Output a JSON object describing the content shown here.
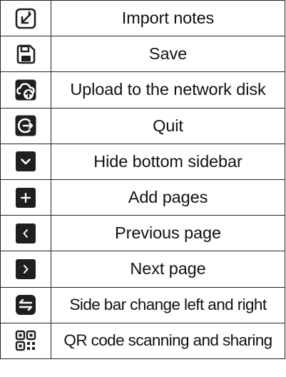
{
  "rows": [
    {
      "icon": "import-icon",
      "label": "Import notes"
    },
    {
      "icon": "save-icon",
      "label": "Save"
    },
    {
      "icon": "cloud-upload-icon",
      "label": "Upload to the network disk"
    },
    {
      "icon": "quit-icon",
      "label": "Quit"
    },
    {
      "icon": "chevron-down-icon",
      "label": "Hide bottom sidebar"
    },
    {
      "icon": "plus-icon",
      "label": "Add pages"
    },
    {
      "icon": "chevron-left-icon",
      "label": "Previous page"
    },
    {
      "icon": "chevron-right-icon",
      "label": "Next page"
    },
    {
      "icon": "swap-arrows-icon",
      "label": "Side bar change left and right"
    },
    {
      "icon": "qr-code-icon",
      "label": "QR code scanning and sharing"
    }
  ],
  "colors": {
    "icon_dark": "#1f1f1f",
    "icon_light": "#ffffff",
    "border": "#222222"
  }
}
